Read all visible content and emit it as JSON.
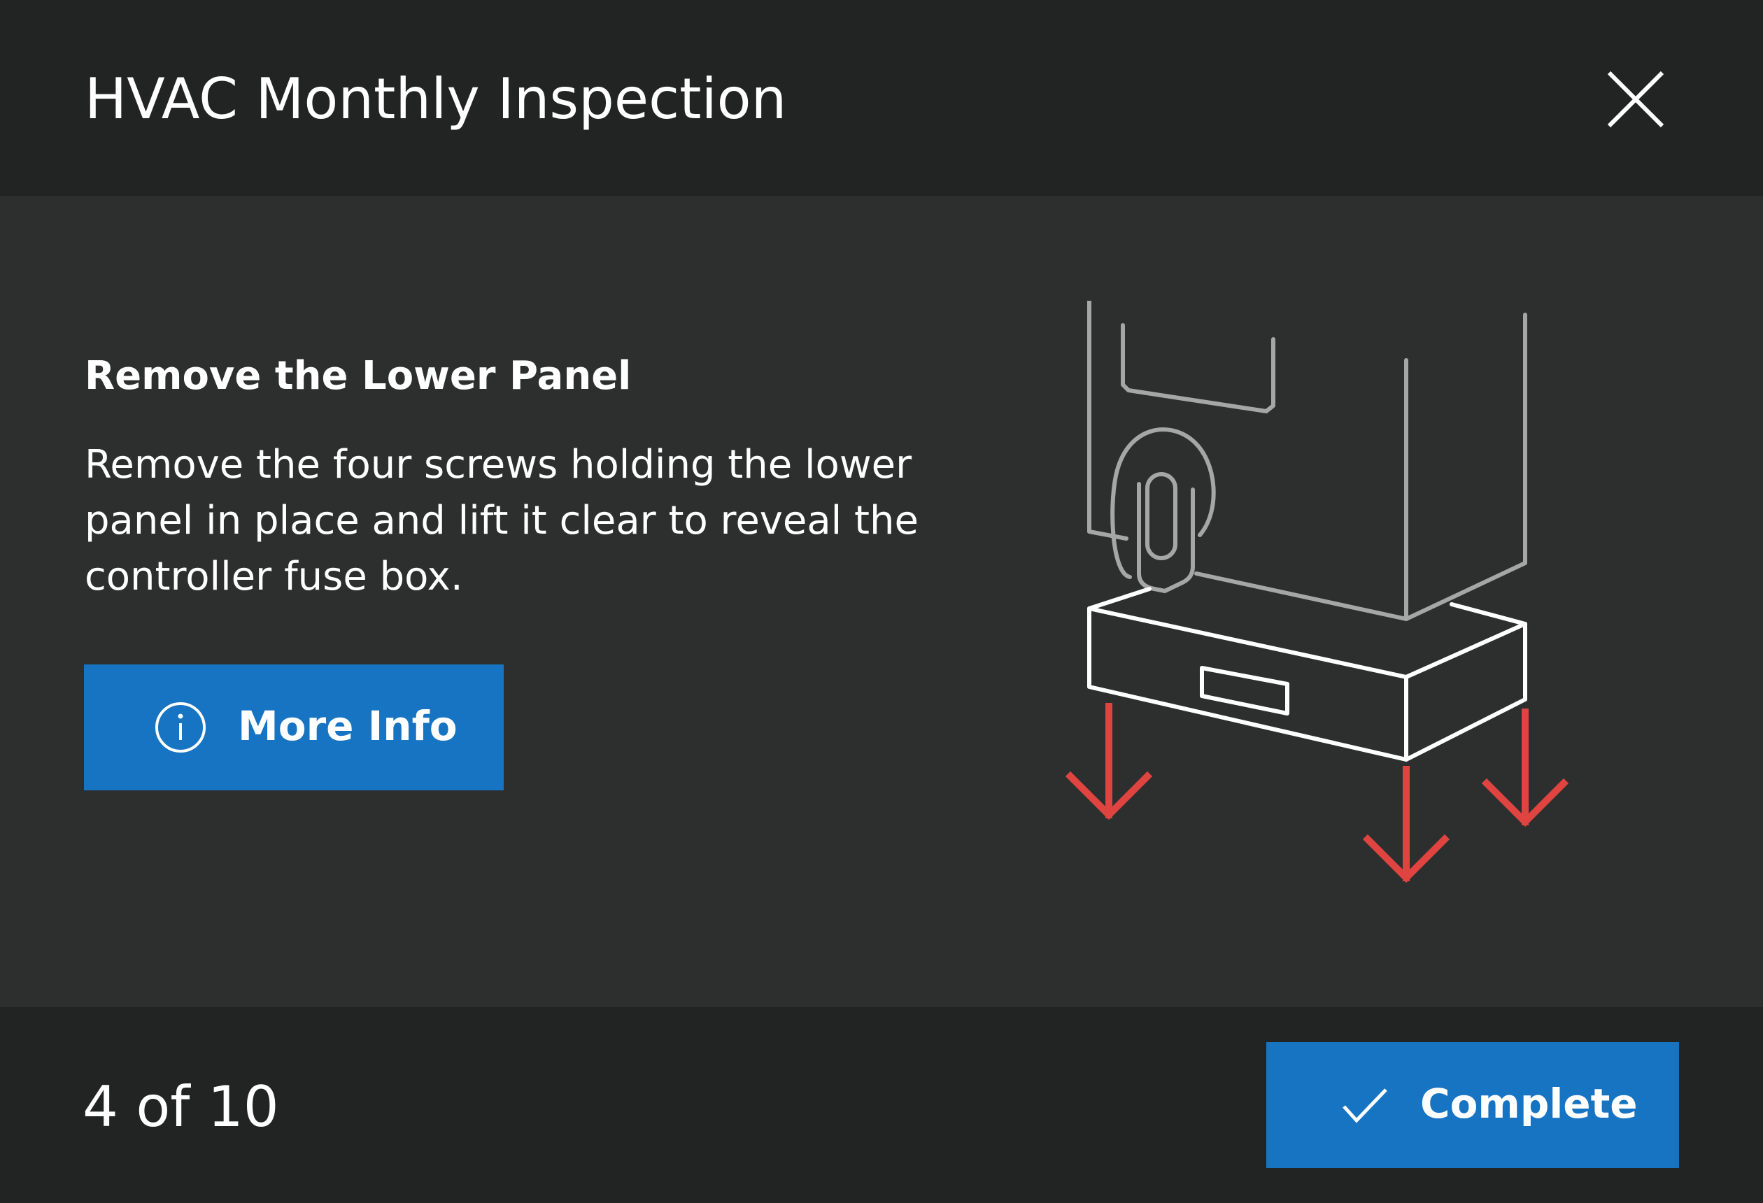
{
  "header": {
    "title": "HVAC Monthly Inspection",
    "close_icon": "close-icon"
  },
  "step": {
    "heading": "Remove the Lower Panel",
    "description": "Remove the four screws holding the lower\npanel in place and lift it clear to reveal the\ncontroller fuse box.",
    "more_info_label": "More Info",
    "more_info_icon": "info-icon",
    "illustration": "lower-panel-removal-illustration"
  },
  "footer": {
    "progress": "4 of 10",
    "complete_label": "Complete",
    "complete_icon": "checkmark-icon"
  },
  "colors": {
    "header_bg": "#222323",
    "body_bg": "#2d2f2f",
    "accent": "#1774c2",
    "arrow": "#e04440"
  }
}
